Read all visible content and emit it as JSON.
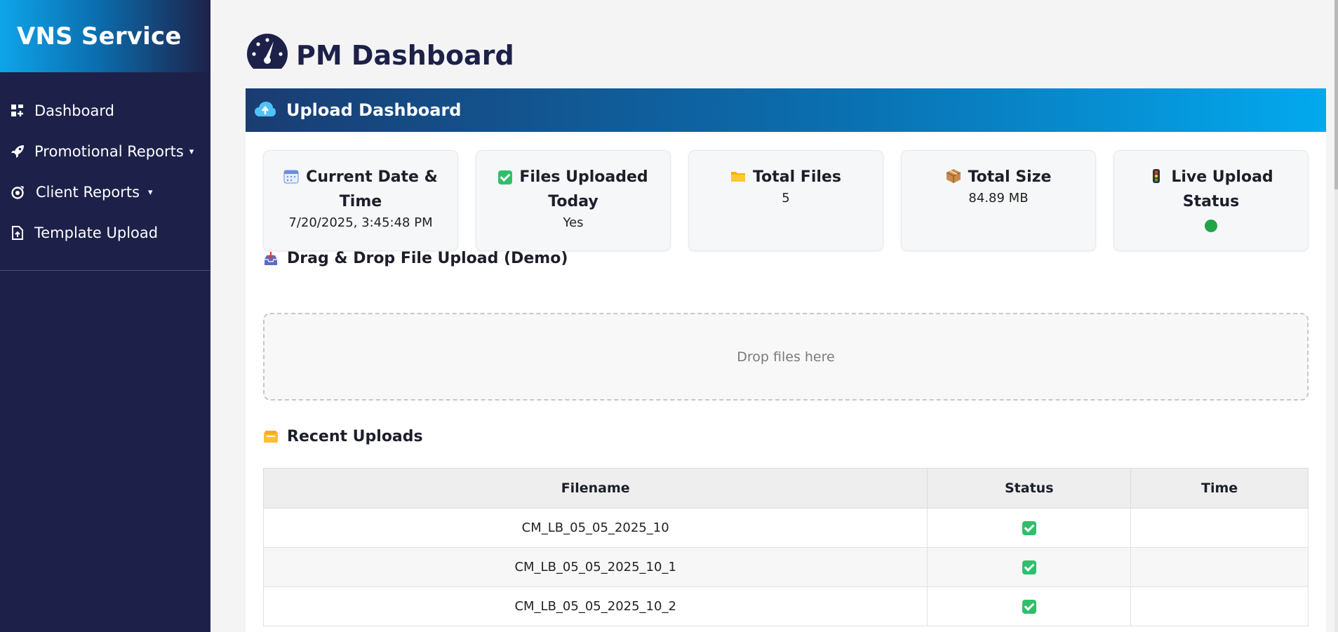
{
  "brand": {
    "title": "VNS Service"
  },
  "sidebar": {
    "items": [
      {
        "label": "Dashboard",
        "icon": "dashboard-grid-icon",
        "has_dropdown": false
      },
      {
        "label": "Promotional Reports",
        "icon": "rocket-icon",
        "has_dropdown": true,
        "caret": "▾"
      },
      {
        "label": "Client Reports",
        "icon": "reports-icon",
        "has_dropdown": true,
        "caret": "▾"
      },
      {
        "label": "Template Upload",
        "icon": "file-upload-icon",
        "has_dropdown": false
      }
    ]
  },
  "page": {
    "title": "PM Dashboard",
    "icon": "gauge-icon"
  },
  "panel": {
    "title": "Upload Dashboard",
    "icon": "cloud-upload-icon"
  },
  "stats": [
    {
      "label": "Current Date & Time",
      "value": "7/20/2025, 3:45:48 PM",
      "icon": "calendar-icon"
    },
    {
      "label": "Files Uploaded Today",
      "value": "Yes",
      "icon": "check-box-icon"
    },
    {
      "label": "Total Files",
      "value": "5",
      "icon": "folder-icon"
    },
    {
      "label": "Total Size",
      "value": "84.89 MB",
      "icon": "package-icon"
    },
    {
      "label": "Live Upload Status",
      "value": "",
      "icon": "traffic-light-icon",
      "status_color": "#22a447"
    }
  ],
  "upload": {
    "title": "Drag & Drop File Upload (Demo)",
    "dropzone_text": "Drop files here",
    "icon": "inbox-tray-icon"
  },
  "recent": {
    "title": "Recent Uploads",
    "icon": "card-index-icon",
    "columns": [
      "Filename",
      "Status",
      "Time"
    ],
    "rows": [
      {
        "filename": "CM_LB_05_05_2025_10",
        "status": "check",
        "time": ""
      },
      {
        "filename": "CM_LB_05_05_2025_10_1",
        "status": "check",
        "time": ""
      },
      {
        "filename": "CM_LB_05_05_2025_10_2",
        "status": "check",
        "time": ""
      }
    ]
  },
  "colors": {
    "sidebar_bg": "#1d2149",
    "accent": "#0b6fb0",
    "accent_light": "#03a9ee",
    "status_green": "#22a447",
    "check_green": "#2fbf6a"
  }
}
